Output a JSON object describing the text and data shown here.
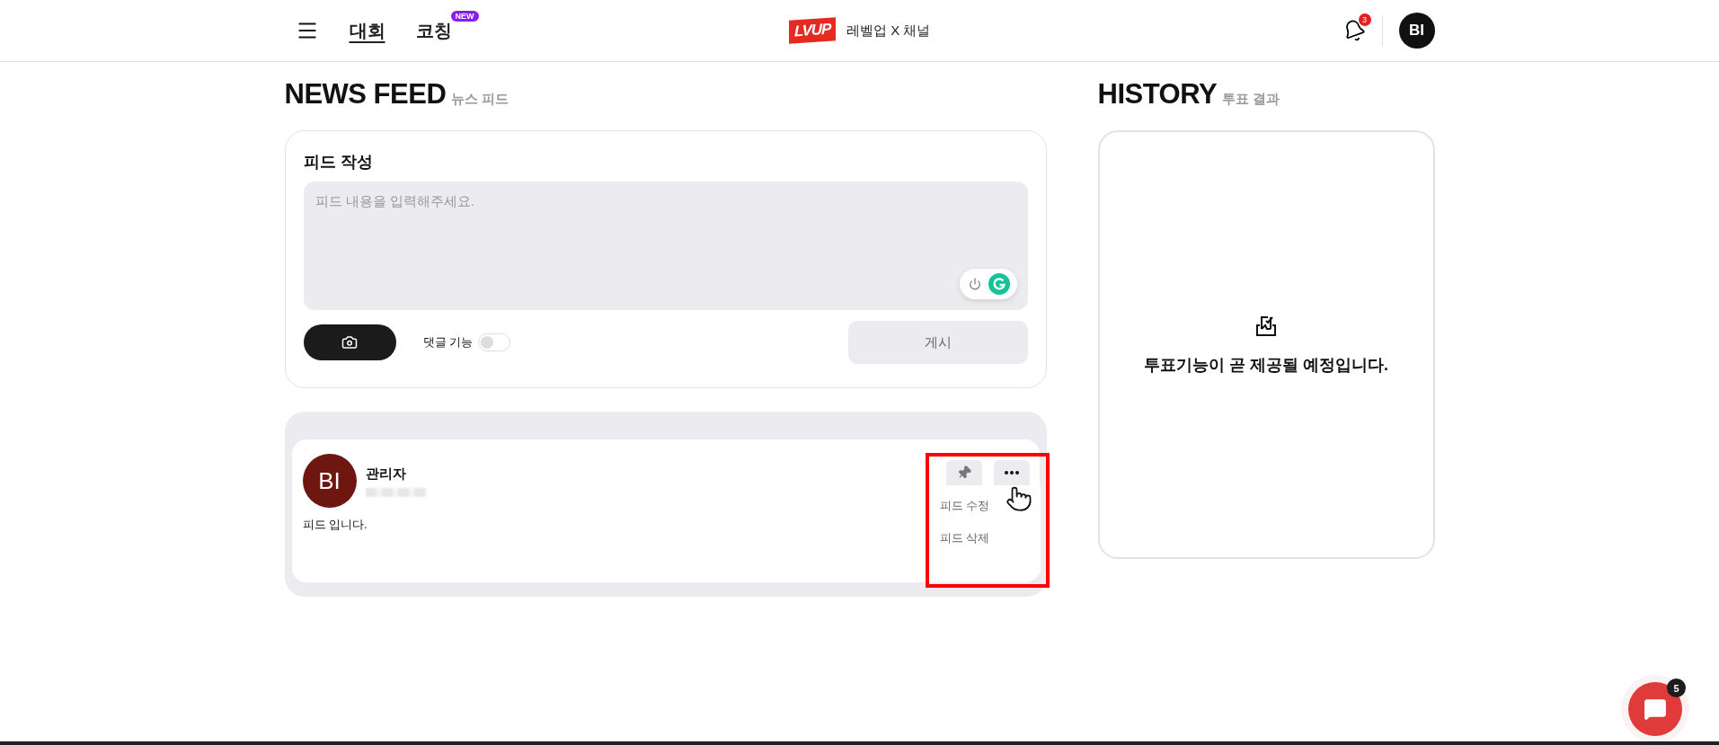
{
  "header": {
    "nav": [
      {
        "label": "대회",
        "selected": true
      },
      {
        "label": "코칭",
        "selected": false,
        "badge": "NEW"
      }
    ],
    "logo": "LVUP",
    "channel": "레벨업 X 채널",
    "notifications": "3",
    "avatar": "BI"
  },
  "news_feed": {
    "title": "NEWS FEED",
    "subtitle": "뉴스 피드"
  },
  "composer": {
    "title": "피드 작성",
    "placeholder": "피드 내용을 입력해주세요.",
    "comment_toggle": {
      "label": "댓글 기능",
      "on": false
    },
    "post_button": "게시"
  },
  "posts": [
    {
      "avatar": "BI",
      "author": "관리자",
      "content": "피드 입니다.",
      "menu": {
        "expanded": true,
        "items": [
          "피드 수정",
          "피드 삭제"
        ]
      }
    }
  ],
  "history": {
    "title": "HISTORY",
    "subtitle": "투표 결과",
    "empty_message": "투표기능이 곧 제공될 예정입니다."
  },
  "chat": {
    "badge": "5"
  }
}
